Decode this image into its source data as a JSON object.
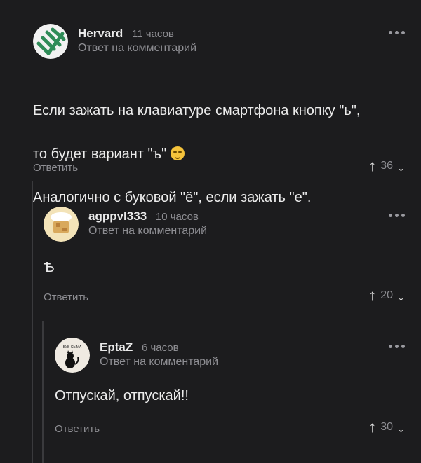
{
  "comments": [
    {
      "author": "Hervard",
      "time": "11 часов",
      "reply_to": "Ответ на комментарий",
      "text_lines": [
        "Если зажать на клавиатуре смартфона кнопку \"ь\",",
        "то будет вариант \"ъ\"",
        "Аналогично с буковой \"ё\", если зажать \"е\"."
      ],
      "reply_label": "Ответить",
      "rating": "36"
    },
    {
      "author": "agppvl333",
      "time": "10 часов",
      "reply_to": "Ответ на комментарий",
      "text": "Ѣ",
      "reply_label": "Ответить",
      "rating": "20"
    },
    {
      "author": "EptaZ",
      "time": "6 часов",
      "reply_to": "Ответ на комментарий",
      "text": "Отпускай, отпускай!!",
      "avatar_caption": "БУБ СЫМА",
      "reply_label": "Ответить",
      "rating": "30"
    }
  ],
  "colors": {
    "background": "#1c1c1e",
    "secondary_text": "#8e8e93",
    "avatar1_green": "#2e8b57"
  },
  "icons": {
    "more": "more-dots-icon",
    "upvote": "arrow-up-icon",
    "downvote": "arrow-down-icon"
  }
}
